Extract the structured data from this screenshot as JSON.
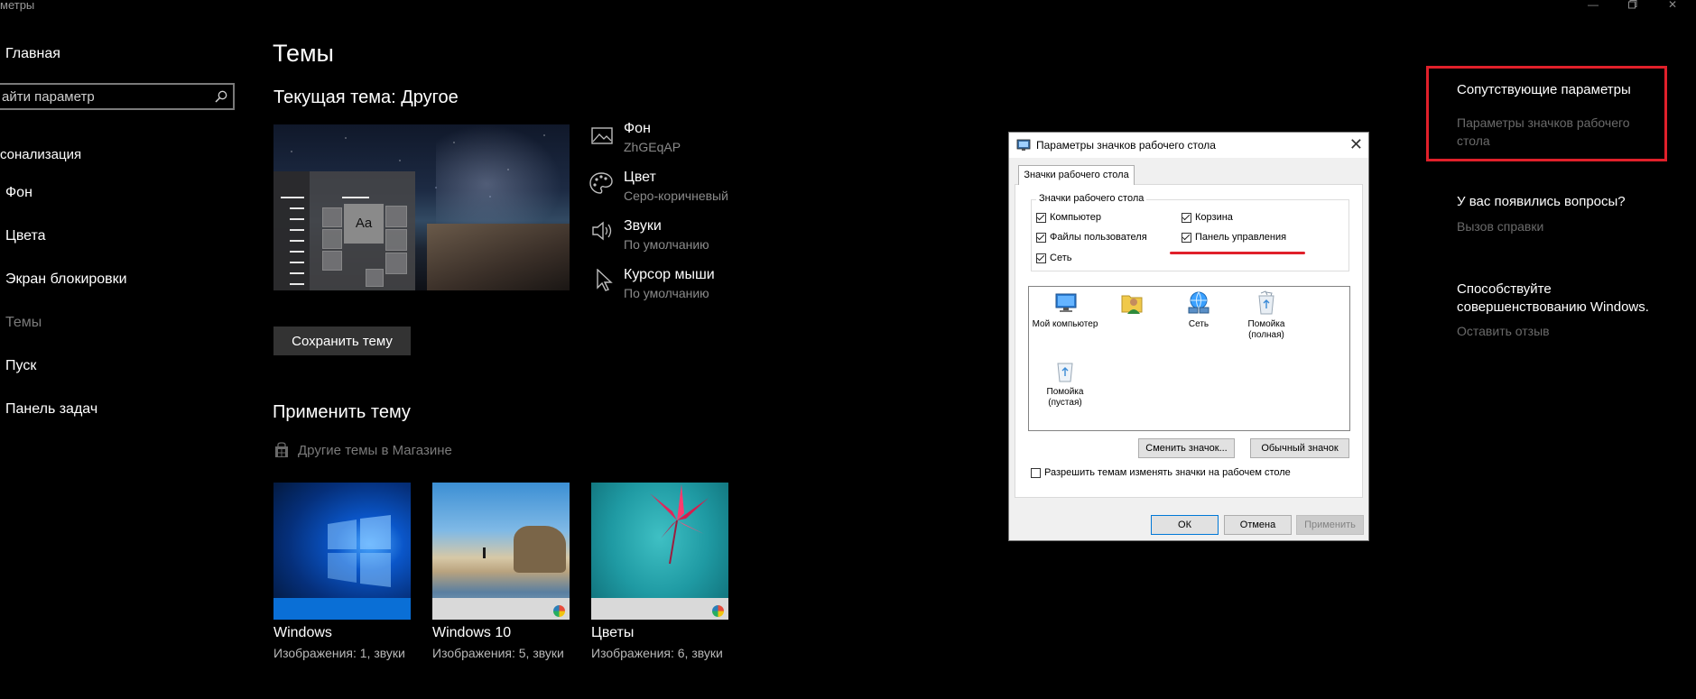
{
  "window": {
    "title": "метры"
  },
  "nav": {
    "home_label": "Главная",
    "search_placeholder": "айти параметр",
    "section_label": "сонализация",
    "items": [
      {
        "label": "Фон"
      },
      {
        "label": "Цвета"
      },
      {
        "label": "Экран блокировки"
      },
      {
        "label": "Темы",
        "selected": true
      },
      {
        "label": "Пуск"
      },
      {
        "label": "Панель задач"
      }
    ]
  },
  "main": {
    "page_title": "Темы",
    "current_theme_label": "Текущая тема: Другое",
    "preview": {
      "tile_text": "Aa"
    },
    "properties": [
      {
        "icon": "picture-icon",
        "label": "Фон",
        "value": "ZhGEqAP"
      },
      {
        "icon": "palette-icon",
        "label": "Цвет",
        "value": "Серо-коричневый"
      },
      {
        "icon": "speaker-icon",
        "label": "Звуки",
        "value": "По умолчанию"
      },
      {
        "icon": "cursor-icon",
        "label": "Курсор мыши",
        "value": "По умолчанию"
      }
    ],
    "save_button": "Сохранить тему",
    "apply_title": "Применить тему",
    "store_link": "Другие темы в Магазине",
    "themes": [
      {
        "name": "Windows",
        "sub": "Изображения: 1, звуки"
      },
      {
        "name": "Windows 10",
        "sub": "Изображения: 5, звуки"
      },
      {
        "name": "Цветы",
        "sub": "Изображения: 6, звуки"
      }
    ]
  },
  "right": {
    "related_title": "Сопутствующие параметры",
    "related_link": "Параметры значков рабочего стола",
    "questions_title": "У вас появились вопросы?",
    "help_link": "Вызов справки",
    "improve_title": "Способствуйте совершенствованию Windows.",
    "feedback_link": "Оставить отзыв"
  },
  "dialog": {
    "title": "Параметры значков рабочего стола",
    "tab": "Значки рабочего стола",
    "group_label": "Значки рабочего стола",
    "checkboxes": [
      {
        "label": "Компьютер",
        "checked": true
      },
      {
        "label": "Корзина",
        "checked": true
      },
      {
        "label": "Файлы пользователя",
        "checked": true
      },
      {
        "label": "Панель управления",
        "checked": true
      },
      {
        "label": "Сеть",
        "checked": true
      }
    ],
    "icons": [
      {
        "name": "monitor-icon",
        "label": "Мой компьютер"
      },
      {
        "name": "user-folder-icon",
        "label": ""
      },
      {
        "name": "network-icon",
        "label": "Сеть"
      },
      {
        "name": "recycle-bin-full-icon",
        "label": "Помойка (полная)"
      },
      {
        "name": "recycle-bin-empty-icon",
        "label": "Помойка (пустая)"
      }
    ],
    "change_icon_button": "Сменить значок...",
    "default_icon_button": "Обычный значок",
    "allow_themes_label": "Разрешить темам изменять значки на рабочем столе",
    "allow_themes_checked": false,
    "ok_button": "ОК",
    "cancel_button": "Отмена",
    "apply_button": "Применить"
  },
  "colors": {
    "background": "#000000",
    "accent_red": "#e0202a",
    "dim_text": "#8a8a8a",
    "windows_blue": "#0078d7"
  }
}
